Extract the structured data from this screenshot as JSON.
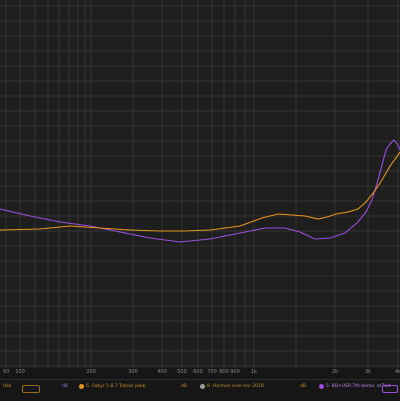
{
  "x_ticks": [
    "50",
    "100",
    "200",
    "300",
    "400",
    "500",
    "600",
    "700",
    "800",
    "900",
    "1k",
    "2k",
    "3k",
    "4k"
  ],
  "legend": {
    "item_0": "Ukk",
    "item_1": "dB",
    "item_2": "6. Sabyr 1.8.7 Tabros jawb",
    "item_3": "dB",
    "item_4": "8. Harman over-ear 2018",
    "item_5": "dB",
    "item_6": "5. 8D+USR.7th bemo. at7w4",
    "item_7": "dB"
  },
  "colors": {
    "orange_curve": "#e8951f",
    "purple_curve": "#9c4fe0",
    "grid": "#3a3a3a",
    "background": "#1e1e1e"
  }
}
